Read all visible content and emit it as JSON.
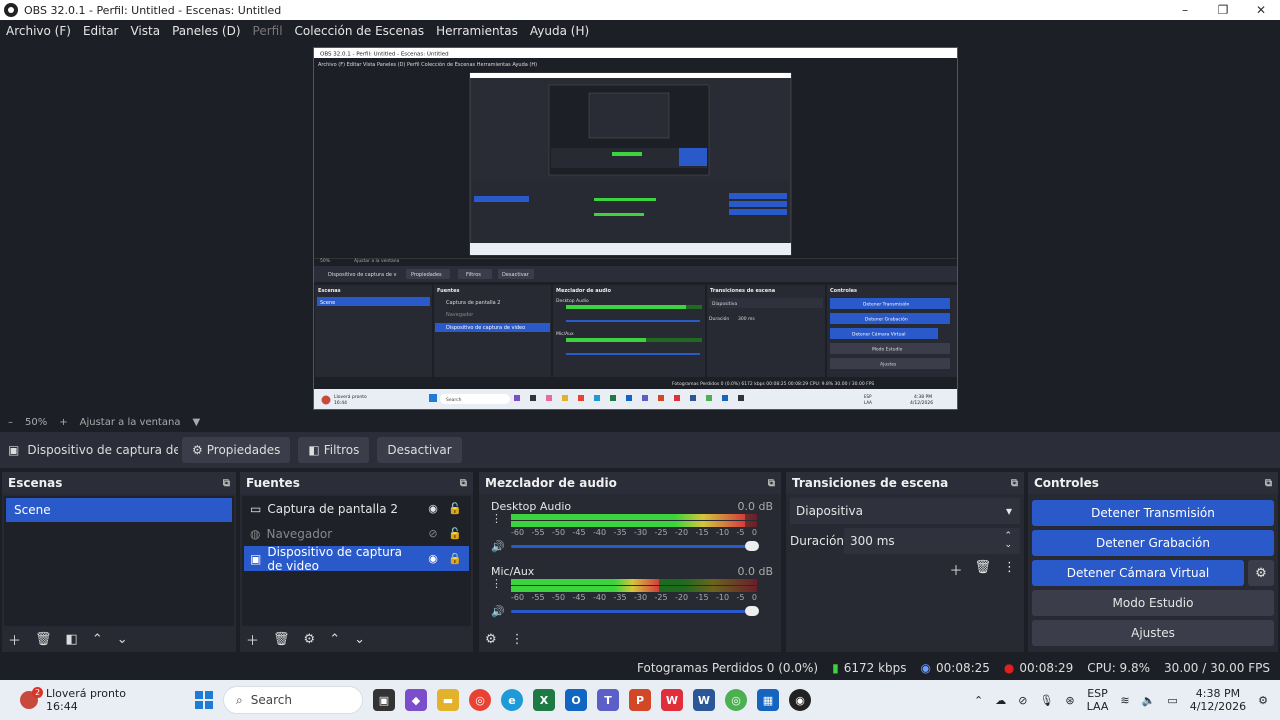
{
  "window": {
    "title": "OBS 32.0.1 - Perfil: Untitled - Escenas: Untitled",
    "min": "–",
    "max": "❐",
    "close": "✕"
  },
  "menu": [
    {
      "label": "Archivo (F)",
      "enabled": true
    },
    {
      "label": "Editar",
      "enabled": true
    },
    {
      "label": "Vista",
      "enabled": true
    },
    {
      "label": "Paneles (D)",
      "enabled": true
    },
    {
      "label": "Perfil",
      "enabled": false
    },
    {
      "label": "Colección de Escenas",
      "enabled": true
    },
    {
      "label": "Herramientas",
      "enabled": true
    },
    {
      "label": "Ayuda (H)",
      "enabled": true
    }
  ],
  "zoom": {
    "minus": "–",
    "value": "50%",
    "plus": "+",
    "fit": "Ajustar a la ventana",
    "caret": "▼"
  },
  "source_bar": {
    "source_name": "Dispositivo de captura de v",
    "properties": "Propiedades",
    "filters": "Filtros",
    "deactivate": "Desactivar"
  },
  "scenes": {
    "title": "Escenas",
    "items": [
      "Scene"
    ]
  },
  "sources": {
    "title": "Fuentes",
    "items": [
      {
        "name": "Captura de pantalla 2",
        "icon": "monitor-icon",
        "visible": true,
        "locked": false
      },
      {
        "name": "Navegador",
        "icon": "globe-icon",
        "visible": false,
        "locked": false
      },
      {
        "name": "Dispositivo de captura de video",
        "icon": "camera-icon",
        "visible": true,
        "locked": true
      }
    ]
  },
  "mixer": {
    "title": "Mezclador de audio",
    "ticks": [
      "-60",
      "-55",
      "-50",
      "-45",
      "-40",
      "-35",
      "-30",
      "-25",
      "-20",
      "-15",
      "-10",
      "-5",
      "0"
    ],
    "channels": [
      {
        "name": "Desktop Audio",
        "db": "0.0 dB",
        "level": 0.95,
        "volume": 1.0
      },
      {
        "name": "Mic/Aux",
        "db": "0.0 dB",
        "level": 0.6,
        "volume": 1.0
      }
    ]
  },
  "transitions": {
    "title": "Transiciones de escena",
    "selected": "Diapositiva",
    "duration_label": "Duración",
    "duration": "300 ms"
  },
  "controls": {
    "title": "Controles",
    "stop_stream": "Detener Transmisión",
    "stop_record": "Detener Grabación",
    "stop_vcam": "Detener Cámara Virtual",
    "studio": "Modo Estudio",
    "settings": "Ajustes"
  },
  "status": {
    "dropped": "Fotogramas Perdidos 0 (0.0%)",
    "kbps": "6172 kbps",
    "stream_time": "00:08:25",
    "rec_time": "00:08:29",
    "cpu": "CPU: 9.8%",
    "fps": "30.00 / 30.00 FPS"
  },
  "taskbar": {
    "weather_line1": "Lloverá pronto",
    "weather_line2": "16:44",
    "weather_badge": "2",
    "search": "Search",
    "lang1": "ESP",
    "lang2": "LAA",
    "time": "4:38 PM",
    "date": "4/12/2026"
  },
  "nested_preview": {
    "title": "OBS 32.0.1 - Perfil: Untitled - Escenas: Untitled",
    "zoom": "50%",
    "fit": "Ajustar a la ventana",
    "source_name": "Dispositivo de captura de v",
    "properties": "Propiedades",
    "filters": "Filtros",
    "deactivate": "Desactivar",
    "scenes_title": "Escenas",
    "sources_title": "Fuentes",
    "mixer_title": "Mezclador de audio",
    "transitions_title": "Transiciones de escena",
    "controls_title": "Controles",
    "scene": "Scene",
    "src1": "Captura de pantalla 2",
    "src2": "Navegador",
    "src3": "Dispositivo de captura de video",
    "desktop_audio": "Desktop Audio",
    "mic": "Mic/Aux",
    "transition": "Diapositiva",
    "duration_label": "Duración",
    "duration": "300 ms",
    "stop_stream": "Detener Transmisión",
    "stop_record": "Detener Grabación",
    "stop_vcam": "Detener Cámara Virtual",
    "studio": "Modo Estudio",
    "settings": "Ajustes",
    "status": "Fotogramas Perdidos 0 (0.0%)   6172 kbps   00:08:25   00:08:29   CPU: 9.8%   30.00 / 30.00 FPS",
    "menu": "Archivo (F)   Editar   Vista   Paneles (D)   Perfil   Colección de Escenas   Herramientas   Ayuda (H)",
    "weather_line1": "Lloverá pronto",
    "weather_line2": "16:44",
    "search": "Search",
    "lang1": "ESP",
    "lang2": "LAA",
    "time": "4:38 PM",
    "date": "4/12/2026"
  }
}
